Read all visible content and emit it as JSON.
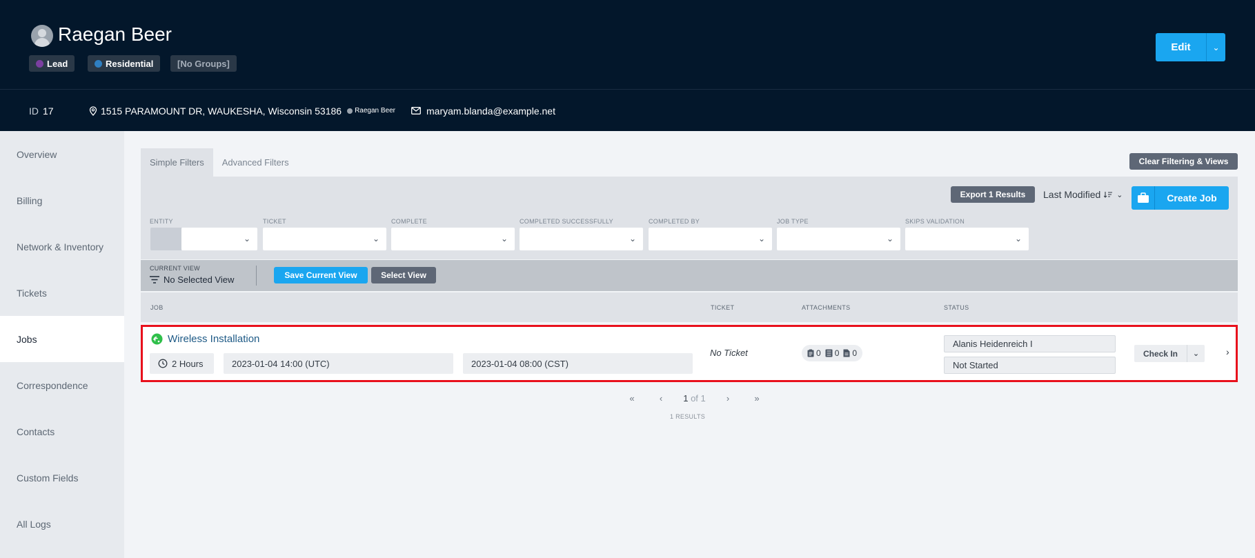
{
  "header": {
    "name": "Raegan Beer",
    "badges": [
      {
        "label": "Lead",
        "dot_color": "#7b3fa0"
      },
      {
        "label": "Residential",
        "dot_color": "#2f7fc1"
      },
      {
        "label": "[No Groups]"
      }
    ],
    "edit_label": "Edit",
    "id_label": "ID",
    "id_value": "17",
    "address": "1515 PARAMOUNT DR, WAUKESHA, Wisconsin 53186",
    "address_owner": "Raegan Beer",
    "email": "maryam.blanda@example.net"
  },
  "sidebar": {
    "items": [
      {
        "label": "Overview"
      },
      {
        "label": "Billing"
      },
      {
        "label": "Network & Inventory"
      },
      {
        "label": "Tickets"
      },
      {
        "label": "Jobs",
        "active": true
      },
      {
        "label": "Correspondence"
      },
      {
        "label": "Contacts"
      },
      {
        "label": "Custom Fields"
      },
      {
        "label": "All Logs"
      }
    ]
  },
  "tabs": [
    "Simple Filters",
    "Advanced Filters"
  ],
  "clear_label": "Clear Filtering & Views",
  "toolbar": {
    "export_label": "Export 1 Results",
    "sort_label": "Last Modified",
    "create_label": "Create Job"
  },
  "filters": {
    "entity": "ENTITY",
    "ticket": "TICKET",
    "complete": "COMPLETE",
    "completed_successfully": "COMPLETED SUCCESSFULLY",
    "completed_by": "COMPLETED BY",
    "job_type": "JOB TYPE",
    "skips_validation": "SKIPS VALIDATION"
  },
  "view": {
    "label": "CURRENT VIEW",
    "value": "No Selected View",
    "save_label": "Save Current View",
    "select_label": "Select View"
  },
  "table": {
    "columns": {
      "job": "JOB",
      "ticket": "TICKET",
      "attachments": "ATTACHMENTS",
      "status": "STATUS"
    },
    "rows": [
      {
        "title": "Wireless Installation",
        "duration": "2 Hours",
        "time_utc": "2023-01-04 14:00 (UTC)",
        "time_cst": "2023-01-04 08:00 (CST)",
        "ticket": "No Ticket",
        "attachments": [
          "0",
          "0",
          "0"
        ],
        "assignee": "Alanis Heidenreich I",
        "status": "Not Started",
        "action_label": "Check In"
      }
    ]
  },
  "pager": {
    "first": "«",
    "prev": "‹",
    "current": "1",
    "of_label": "of",
    "total": "1",
    "next": "›",
    "last": "»",
    "results": "1 RESULTS"
  },
  "colors": {
    "accent": "#1aa6f0",
    "header_bg": "#03172b",
    "highlight": "#e8101c"
  }
}
